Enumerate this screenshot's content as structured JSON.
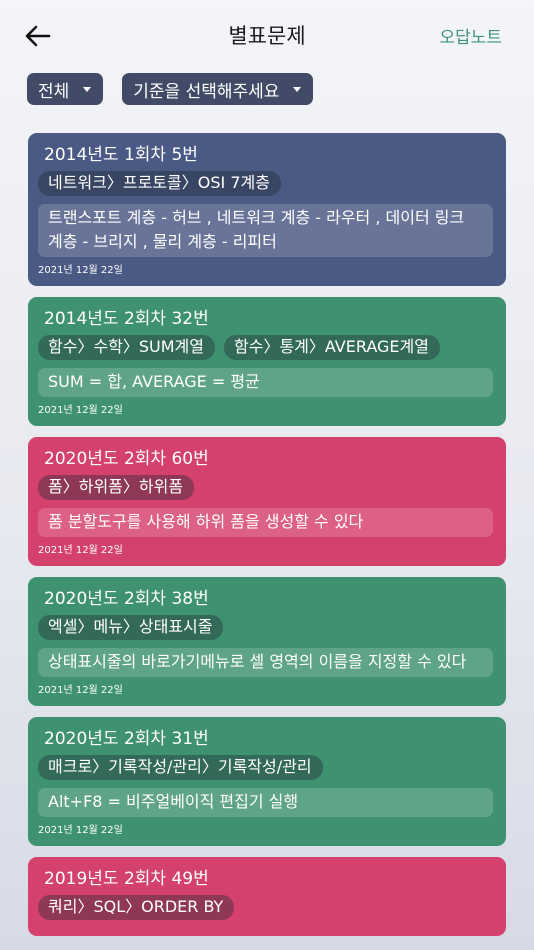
{
  "header": {
    "title": "별표문제",
    "wrong_note_label": "오답노트"
  },
  "filters": {
    "category": "전체",
    "criteria": "기준을 선택해주세요"
  },
  "cards": [
    {
      "color": "#4a5a84",
      "title": "2014년도 1회차 5번",
      "tags": [
        "네트워크〉프로토콜〉OSI 7계층"
      ],
      "answer": "트랜스포트 계층 - 허브 , 네트워크 계층 - 라우터 , 데이터 링크 계층 - 브리지 , 물리 계층 - 리피터",
      "date": "2021년 12월 22일"
    },
    {
      "color": "#3f9270",
      "title": "2014년도 2회차 32번",
      "tags": [
        "함수〉수학〉SUM계열",
        "함수〉통계〉AVERAGE계열"
      ],
      "answer": "SUM = 합, AVERAGE = 평균",
      "date": "2021년 12월 22일"
    },
    {
      "color": "#d5416d",
      "title": "2020년도 2회차 60번",
      "tags": [
        "폼〉하위폼〉하위폼"
      ],
      "answer": "폼 분할도구를 사용해 하위 폼을 생성할 수 있다",
      "date": "2021년 12월 22일"
    },
    {
      "color": "#3f9270",
      "title": "2020년도 2회차 38번",
      "tags": [
        "엑셀〉메뉴〉상태표시줄"
      ],
      "answer": "상태표시줄의 바로가기메뉴로 셀 영역의 이름을 지정할 수 있다",
      "date": "2021년 12월 22일"
    },
    {
      "color": "#3f9270",
      "title": "2020년도 2회차 31번",
      "tags": [
        "매크로〉기록작성/관리〉기록작성/관리"
      ],
      "answer": "Alt+F8 = 비주얼베이직 편집기 실행",
      "date": "2021년 12월 22일"
    },
    {
      "color": "#d5416d",
      "title": "2019년도 2회차 49번",
      "tags": [
        "쿼리〉SQL〉ORDER BY"
      ],
      "answer": "",
      "date": ""
    }
  ]
}
